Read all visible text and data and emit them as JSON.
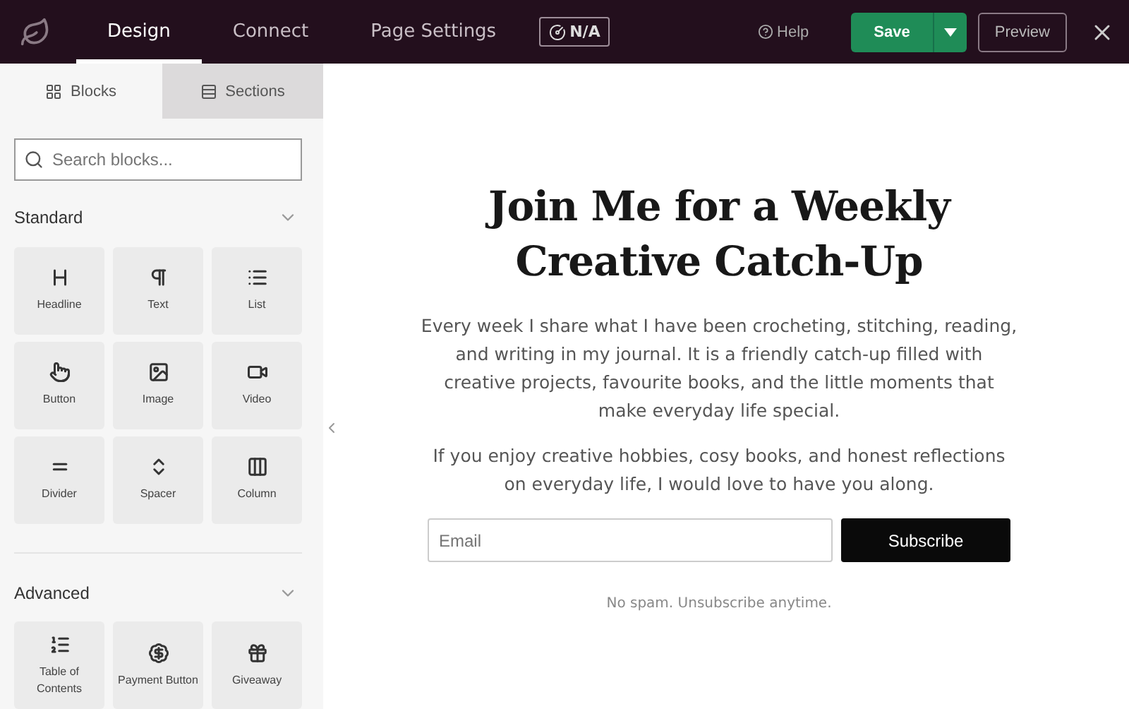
{
  "top_tabs": [
    {
      "label": "Design",
      "selected": true
    },
    {
      "label": "Connect",
      "selected": false
    },
    {
      "label": "Page Settings",
      "selected": false
    }
  ],
  "status_badge": "N/A",
  "help": "Help",
  "save": "Save",
  "preview": "Preview",
  "panel_tabs": [
    {
      "label": "Blocks",
      "selected": true
    },
    {
      "label": "Sections",
      "selected": false
    }
  ],
  "search": {
    "placeholder": "Search blocks..."
  },
  "groups": [
    {
      "title": "Standard",
      "expanded": true,
      "blocks": [
        "Headline",
        "Text",
        "List",
        "Button",
        "Image",
        "Video",
        "Divider",
        "Spacer",
        "Column"
      ]
    },
    {
      "title": "Advanced",
      "expanded": true,
      "blocks": [
        "Table of Contents",
        "Payment Button",
        "Giveaway"
      ]
    }
  ],
  "page": {
    "heading": "Join Me for a Weekly Creative Catch-Up",
    "paragraphs": [
      "Every week I share what I have been crocheting, stitching, reading, and writing in my journal. It is a friendly catch-up filled with creative projects, favourite books, and the little moments that make everyday life special.",
      "If you enjoy creative hobbies, cosy books, and honest reflections on everyday life, I would love to have you along."
    ],
    "email": {
      "placeholder": "Email"
    },
    "subscribe": "Subscribe",
    "note": "No spam. Unsubscribe anytime."
  }
}
